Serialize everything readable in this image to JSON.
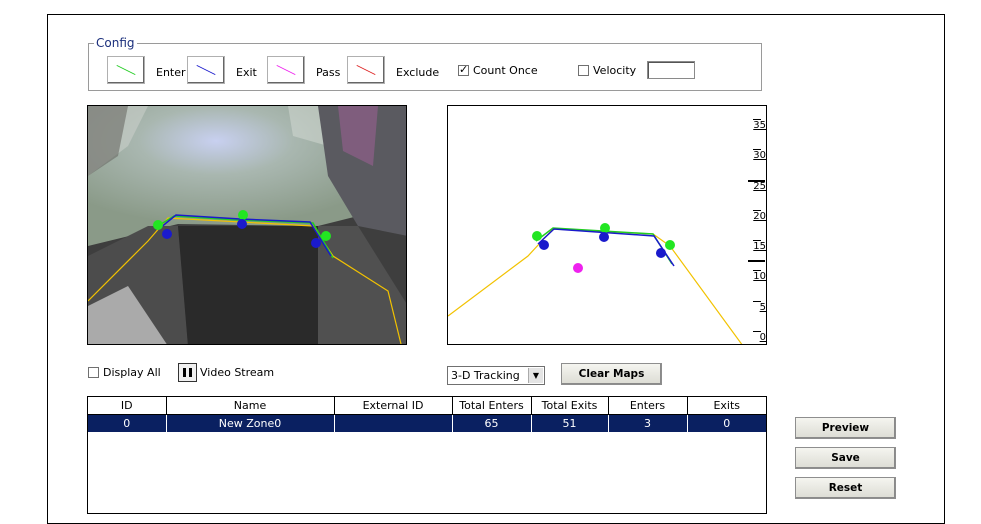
{
  "config": {
    "title": "Config",
    "swatches": [
      {
        "label": "Enter",
        "color": "#22cc22",
        "icon": "green-line-icon"
      },
      {
        "label": "Exit",
        "color": "#1a1acc",
        "icon": "blue-line-icon"
      },
      {
        "label": "Pass",
        "color": "#ee22ee",
        "icon": "magenta-line-icon"
      },
      {
        "label": "Exclude",
        "color": "#dd2222",
        "icon": "red-line-icon"
      }
    ],
    "count_once": {
      "label": "Count Once",
      "checked": true
    },
    "velocity": {
      "label": "Velocity",
      "checked": false,
      "value": ""
    }
  },
  "map": {
    "scale_labels": [
      "35",
      "30",
      "25",
      "20",
      "15",
      "10",
      "5",
      "0"
    ]
  },
  "controls": {
    "display_all": {
      "label": "Display All",
      "checked": false
    },
    "video_stream_label": "Video Stream",
    "tracking_select": "3-D Tracking",
    "clear_maps": "Clear Maps"
  },
  "table": {
    "columns": [
      "ID",
      "Name",
      "External ID",
      "Total Enters",
      "Total Exits",
      "Enters",
      "Exits"
    ],
    "rows": [
      [
        "0",
        "New Zone0",
        "",
        "65",
        "51",
        "3",
        "0"
      ]
    ]
  },
  "buttons": {
    "preview": "Preview",
    "save": "Save",
    "reset": "Reset"
  },
  "colors": {
    "accent_title": "#1b2f7c",
    "selected_row": "#0a2061",
    "enter_line": "#22cc22",
    "exit_line": "#1a1acc",
    "track_line": "#f2c200"
  }
}
